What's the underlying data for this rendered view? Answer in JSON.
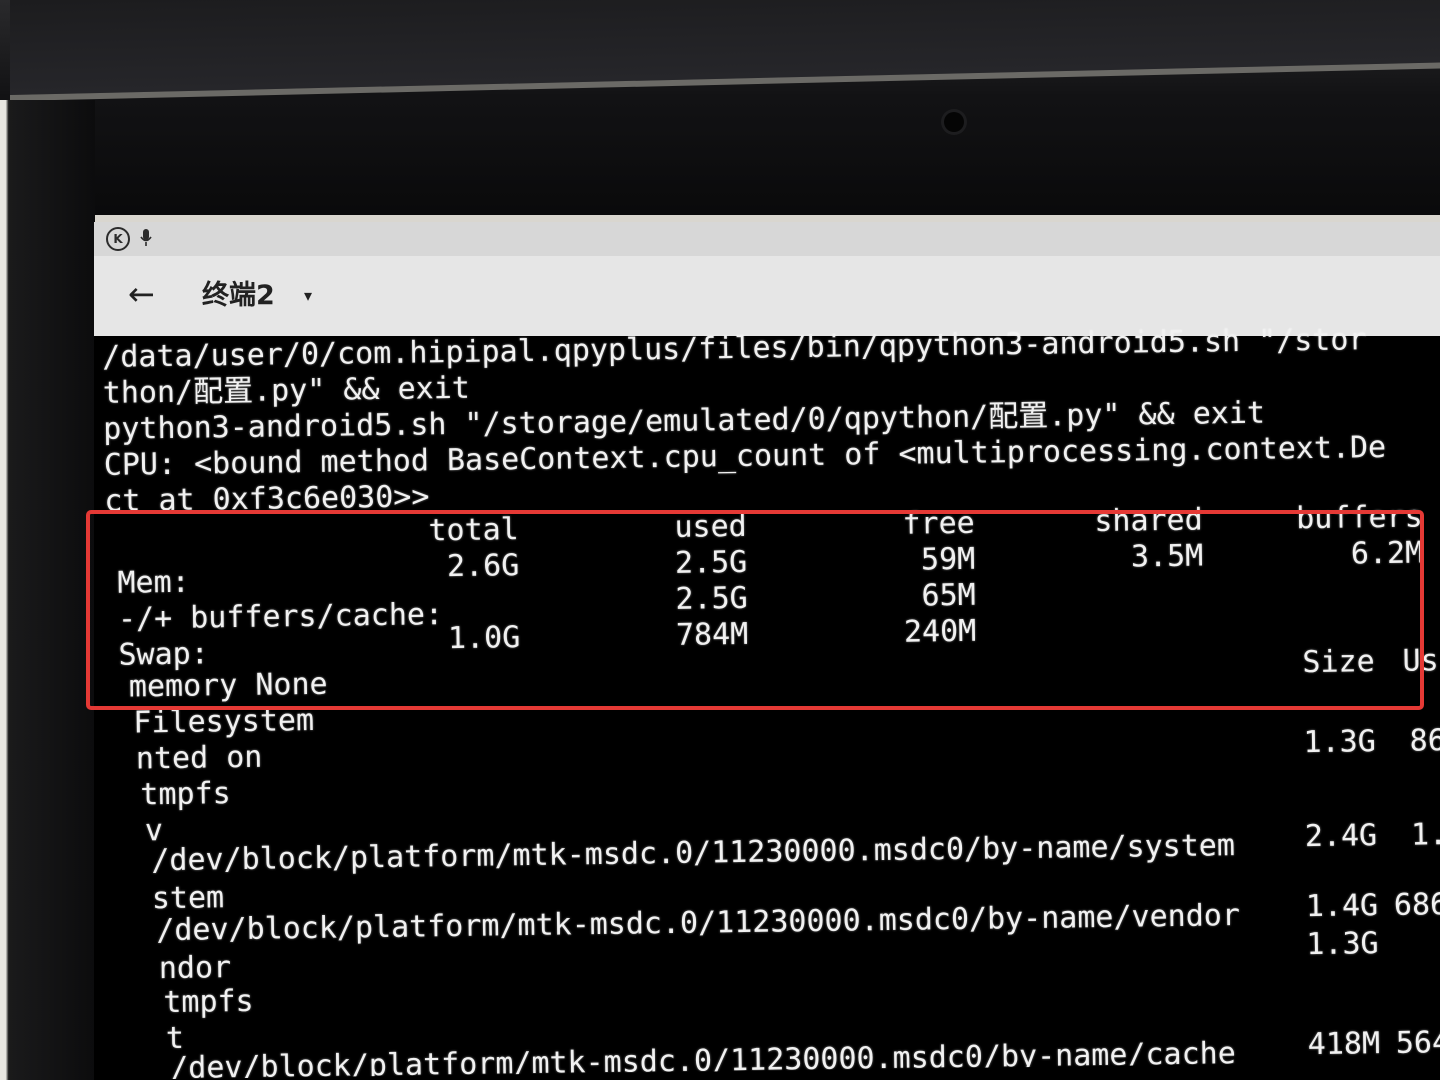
{
  "statusbar": {
    "k_icon": "K",
    "mic_icon": "mic-icon"
  },
  "appbar": {
    "back_icon": "←",
    "title": "终端2",
    "dropdown_icon": "▾"
  },
  "terminal": {
    "cmd_lines": [
      "/data/user/0/com.hipipal.qpyplus/files/bin/qpython3-android5.sh \"/stor",
      "thon/配置.py\" && exit",
      "python3-android5.sh \"/storage/emulated/0/qpython/配置.py\" && exit",
      "CPU: <bound method BaseContext.cpu_count of <multiprocessing.context.De",
      "ct at 0xf3c6e030>>"
    ],
    "mem_headers": [
      "total",
      "used",
      "free",
      "shared",
      "buffers"
    ],
    "mem_rows": [
      {
        "label": "Mem:",
        "total": "2.6G",
        "used": "2.5G",
        "free": "59M",
        "shared": "3.5M",
        "buffers": "6.2M"
      },
      {
        "label": "-/+ buffers/cache:",
        "total": "",
        "used": "2.5G",
        "free": "65M",
        "shared": "",
        "buffers": ""
      },
      {
        "label": "Swap:",
        "total": "1.0G",
        "used": "784M",
        "free": "240M",
        "shared": "",
        "buffers": ""
      }
    ],
    "memory_line": "memory None",
    "df_header": {
      "size": "Size",
      "used": "Us"
    },
    "df_lines": [
      {
        "text": "Filesystem",
        "size": "",
        "used": ""
      },
      {
        "text": "nted on",
        "size": "1.3G",
        "used": "86"
      },
      {
        "text": "tmpfs",
        "size": "",
        "used": ""
      },
      {
        "text": "v",
        "size": "",
        "used": ""
      },
      {
        "text": "/dev/block/platform/mtk-msdc.0/11230000.msdc0/by-name/system",
        "size": "2.4G",
        "used": "1."
      },
      {
        "text": "stem",
        "size": "",
        "used": ""
      },
      {
        "text": "/dev/block/platform/mtk-msdc.0/11230000.msdc0/by-name/vendor",
        "size": "1.4G",
        "used": "686"
      },
      {
        "text": "ndor",
        "size": "1.3G",
        "used": ""
      },
      {
        "text": "tmpfs",
        "size": "",
        "used": ""
      },
      {
        "text": "t",
        "size": "",
        "used": ""
      },
      {
        "text": "/dev/block/platform/mtk-msdc.0/11230000.msdc0/by-name/cache",
        "size": "418M",
        "used": "564"
      }
    ]
  },
  "colors": {
    "highlight": "#e53935",
    "terminal_bg": "#000000",
    "terminal_fg": "#f1f1f1"
  }
}
